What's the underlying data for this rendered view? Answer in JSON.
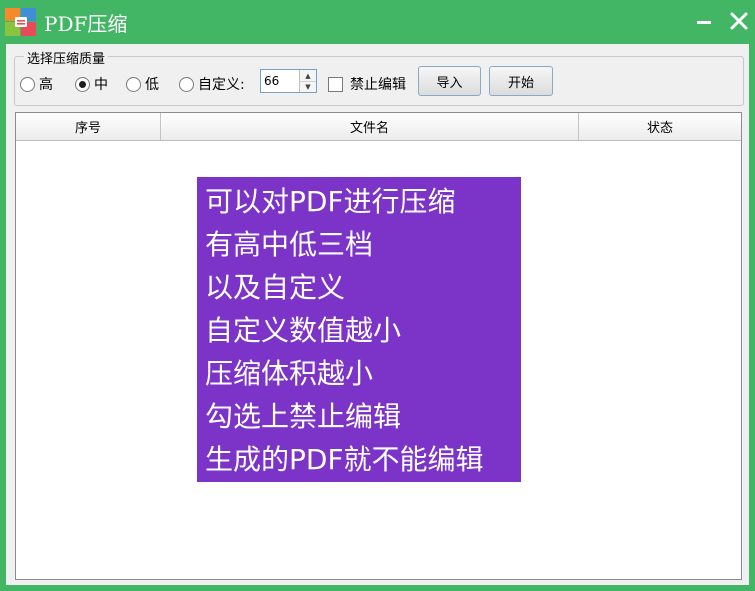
{
  "window": {
    "title": "PDF压缩"
  },
  "quality_group": {
    "legend": "选择压缩质量",
    "options": [
      {
        "label": "高",
        "selected": false
      },
      {
        "label": "中",
        "selected": true
      },
      {
        "label": "低",
        "selected": false
      }
    ],
    "custom_label": "自定义:",
    "custom_value": "66"
  },
  "disable_edit": {
    "label": "禁止编辑",
    "checked": false
  },
  "toolbar": {
    "import_label": "导入",
    "start_label": "开始"
  },
  "table": {
    "columns": [
      "序号",
      "文件名",
      "状态"
    ],
    "rows": []
  },
  "overlay": {
    "lines": [
      "可以对PDF进行压缩",
      "有高中低三档",
      "以及自定义",
      "自定义数值越小",
      "压缩体积越小",
      "勾选上禁止编辑",
      "生成的PDF就不能编辑"
    ]
  },
  "colors": {
    "titlebar": "#42b665",
    "client_bg": "#f0f0f0",
    "overlay_bg": "#7b33c8",
    "overlay_text": "#ffffff"
  },
  "icons": {
    "app": "app-logo-icon",
    "minimize": "minimize-icon",
    "close": "close-icon",
    "spin_up": "spin-up-arrow-icon",
    "spin_down": "spin-down-arrow-icon"
  }
}
